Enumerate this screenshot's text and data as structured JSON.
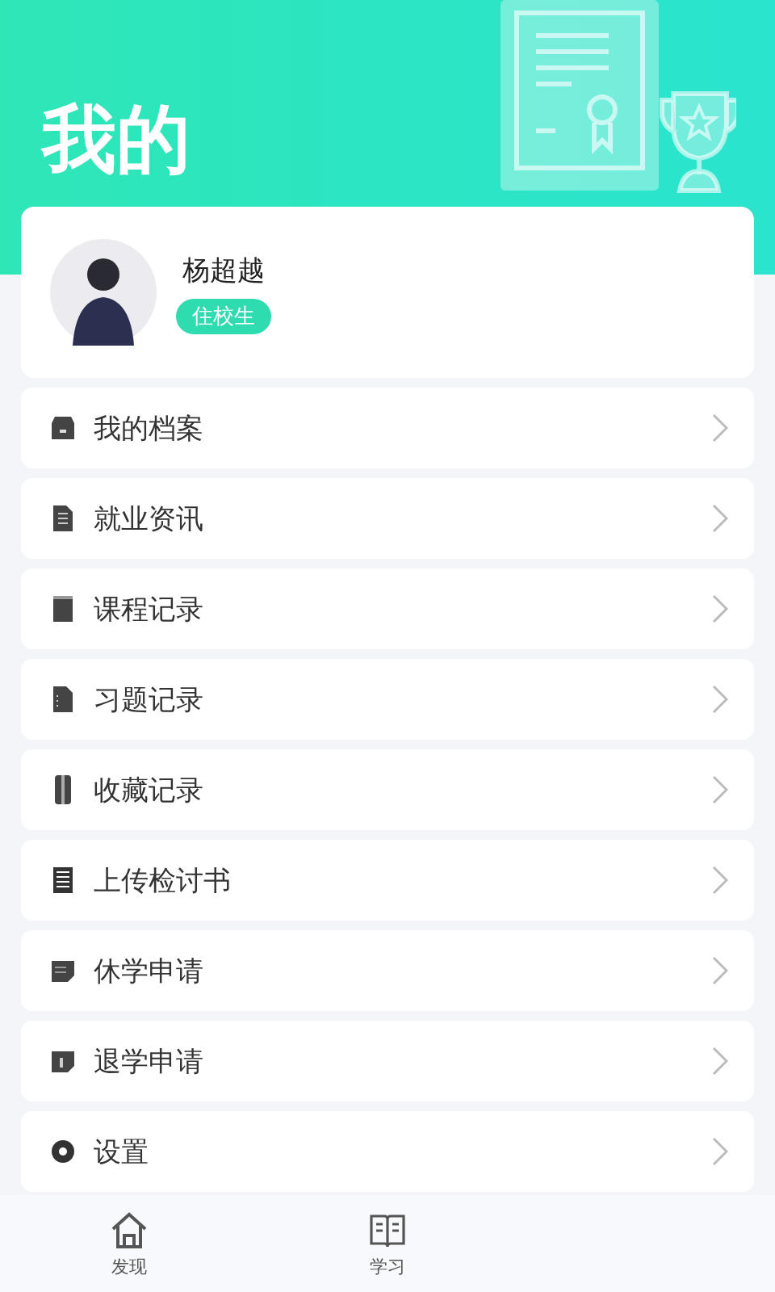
{
  "header": {
    "title": "我的"
  },
  "profile": {
    "name": "杨超越",
    "badge": "住校生"
  },
  "menu": [
    {
      "label": "我的档案",
      "kind": "archive"
    },
    {
      "label": "就业资讯",
      "kind": "document"
    },
    {
      "label": "课程记录",
      "kind": "book"
    },
    {
      "label": "习题记录",
      "kind": "list"
    },
    {
      "label": "收藏记录",
      "kind": "bookmark"
    },
    {
      "label": "上传检讨书",
      "kind": "notepad"
    },
    {
      "label": "休学申请",
      "kind": "note"
    },
    {
      "label": "退学申请",
      "kind": "notealert"
    },
    {
      "label": "设置",
      "kind": "gear"
    }
  ],
  "tabbar": [
    {
      "label": "发现",
      "kind": "home",
      "selected": false
    },
    {
      "label": "学习",
      "kind": "book",
      "selected": false
    }
  ]
}
